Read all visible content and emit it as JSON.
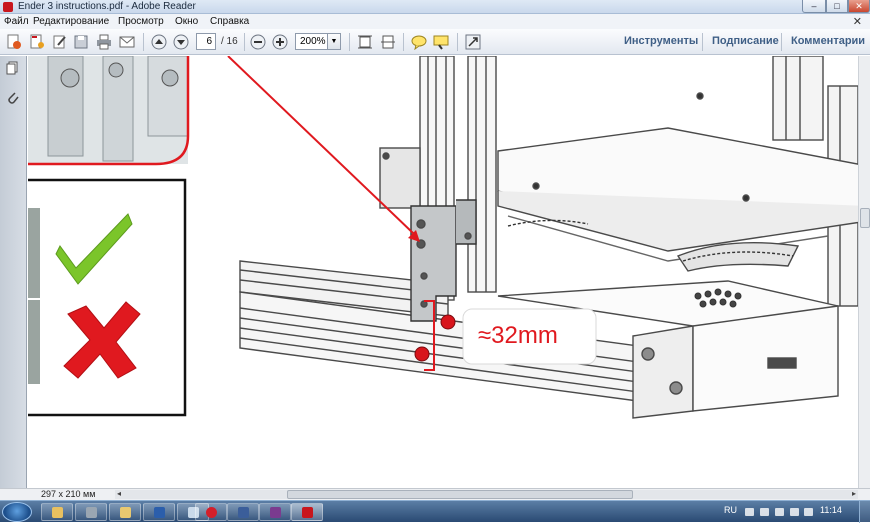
{
  "window": {
    "title": "Ender 3 instructions.pdf - Adobe Reader"
  },
  "menu": {
    "items": [
      "Файл",
      "Редактирование",
      "Просмотр",
      "Окно",
      "Справка"
    ],
    "close_doc": "✕"
  },
  "toolbar": {
    "page_current": "6",
    "page_total": "/ 16",
    "zoom": "200%",
    "links": [
      "Инструменты",
      "Подписание",
      "Комментарии"
    ]
  },
  "document": {
    "dimension_label": "≈32mm",
    "check_mark": "correct-check-icon",
    "cross_mark": "wrong-cross-icon"
  },
  "status": {
    "page_size": "297 x 210 мм"
  },
  "taskbar": {
    "language": "RU",
    "clock": "11:14"
  },
  "colors": {
    "accent_red": "#e0191f",
    "check_green": "#7bc52a",
    "link_blue": "#3f5f86"
  }
}
